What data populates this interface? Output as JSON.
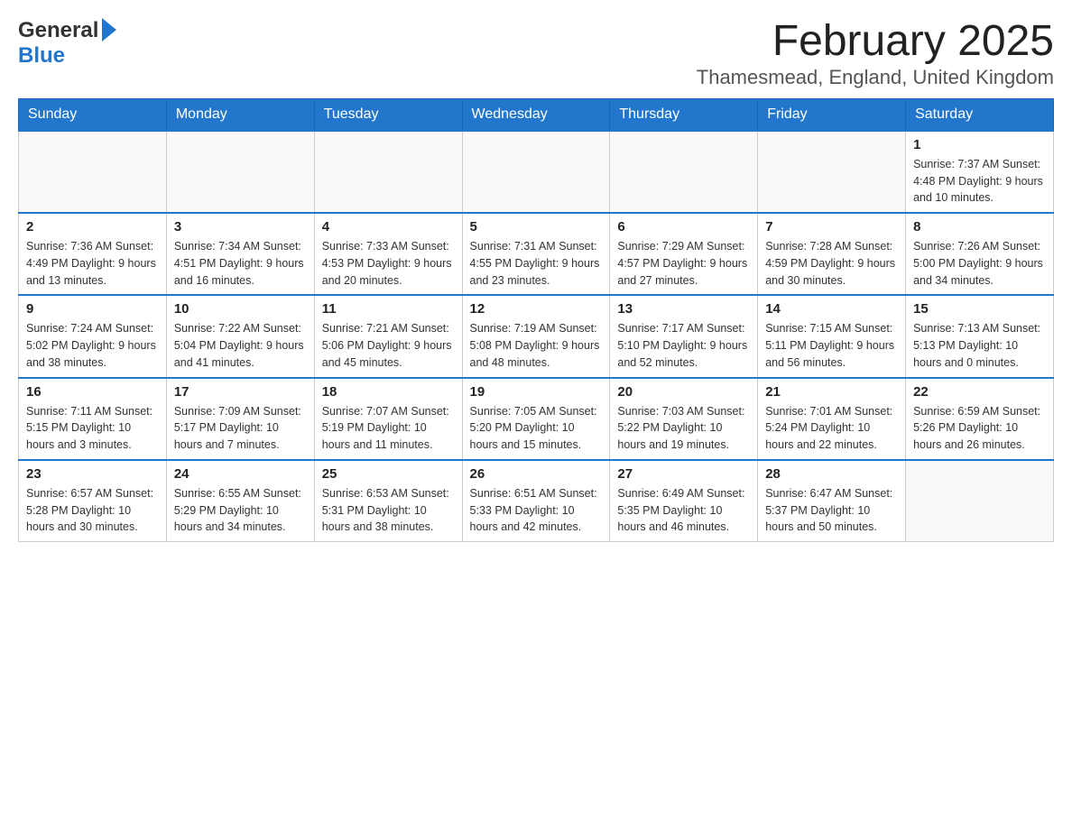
{
  "header": {
    "logo_general": "General",
    "logo_blue": "Blue",
    "title": "February 2025",
    "subtitle": "Thamesmead, England, United Kingdom"
  },
  "calendar": {
    "days_of_week": [
      "Sunday",
      "Monday",
      "Tuesday",
      "Wednesday",
      "Thursday",
      "Friday",
      "Saturday"
    ],
    "weeks": [
      [
        {
          "day": "",
          "info": ""
        },
        {
          "day": "",
          "info": ""
        },
        {
          "day": "",
          "info": ""
        },
        {
          "day": "",
          "info": ""
        },
        {
          "day": "",
          "info": ""
        },
        {
          "day": "",
          "info": ""
        },
        {
          "day": "1",
          "info": "Sunrise: 7:37 AM\nSunset: 4:48 PM\nDaylight: 9 hours and 10 minutes."
        }
      ],
      [
        {
          "day": "2",
          "info": "Sunrise: 7:36 AM\nSunset: 4:49 PM\nDaylight: 9 hours and 13 minutes."
        },
        {
          "day": "3",
          "info": "Sunrise: 7:34 AM\nSunset: 4:51 PM\nDaylight: 9 hours and 16 minutes."
        },
        {
          "day": "4",
          "info": "Sunrise: 7:33 AM\nSunset: 4:53 PM\nDaylight: 9 hours and 20 minutes."
        },
        {
          "day": "5",
          "info": "Sunrise: 7:31 AM\nSunset: 4:55 PM\nDaylight: 9 hours and 23 minutes."
        },
        {
          "day": "6",
          "info": "Sunrise: 7:29 AM\nSunset: 4:57 PM\nDaylight: 9 hours and 27 minutes."
        },
        {
          "day": "7",
          "info": "Sunrise: 7:28 AM\nSunset: 4:59 PM\nDaylight: 9 hours and 30 minutes."
        },
        {
          "day": "8",
          "info": "Sunrise: 7:26 AM\nSunset: 5:00 PM\nDaylight: 9 hours and 34 minutes."
        }
      ],
      [
        {
          "day": "9",
          "info": "Sunrise: 7:24 AM\nSunset: 5:02 PM\nDaylight: 9 hours and 38 minutes."
        },
        {
          "day": "10",
          "info": "Sunrise: 7:22 AM\nSunset: 5:04 PM\nDaylight: 9 hours and 41 minutes."
        },
        {
          "day": "11",
          "info": "Sunrise: 7:21 AM\nSunset: 5:06 PM\nDaylight: 9 hours and 45 minutes."
        },
        {
          "day": "12",
          "info": "Sunrise: 7:19 AM\nSunset: 5:08 PM\nDaylight: 9 hours and 48 minutes."
        },
        {
          "day": "13",
          "info": "Sunrise: 7:17 AM\nSunset: 5:10 PM\nDaylight: 9 hours and 52 minutes."
        },
        {
          "day": "14",
          "info": "Sunrise: 7:15 AM\nSunset: 5:11 PM\nDaylight: 9 hours and 56 minutes."
        },
        {
          "day": "15",
          "info": "Sunrise: 7:13 AM\nSunset: 5:13 PM\nDaylight: 10 hours and 0 minutes."
        }
      ],
      [
        {
          "day": "16",
          "info": "Sunrise: 7:11 AM\nSunset: 5:15 PM\nDaylight: 10 hours and 3 minutes."
        },
        {
          "day": "17",
          "info": "Sunrise: 7:09 AM\nSunset: 5:17 PM\nDaylight: 10 hours and 7 minutes."
        },
        {
          "day": "18",
          "info": "Sunrise: 7:07 AM\nSunset: 5:19 PM\nDaylight: 10 hours and 11 minutes."
        },
        {
          "day": "19",
          "info": "Sunrise: 7:05 AM\nSunset: 5:20 PM\nDaylight: 10 hours and 15 minutes."
        },
        {
          "day": "20",
          "info": "Sunrise: 7:03 AM\nSunset: 5:22 PM\nDaylight: 10 hours and 19 minutes."
        },
        {
          "day": "21",
          "info": "Sunrise: 7:01 AM\nSunset: 5:24 PM\nDaylight: 10 hours and 22 minutes."
        },
        {
          "day": "22",
          "info": "Sunrise: 6:59 AM\nSunset: 5:26 PM\nDaylight: 10 hours and 26 minutes."
        }
      ],
      [
        {
          "day": "23",
          "info": "Sunrise: 6:57 AM\nSunset: 5:28 PM\nDaylight: 10 hours and 30 minutes."
        },
        {
          "day": "24",
          "info": "Sunrise: 6:55 AM\nSunset: 5:29 PM\nDaylight: 10 hours and 34 minutes."
        },
        {
          "day": "25",
          "info": "Sunrise: 6:53 AM\nSunset: 5:31 PM\nDaylight: 10 hours and 38 minutes."
        },
        {
          "day": "26",
          "info": "Sunrise: 6:51 AM\nSunset: 5:33 PM\nDaylight: 10 hours and 42 minutes."
        },
        {
          "day": "27",
          "info": "Sunrise: 6:49 AM\nSunset: 5:35 PM\nDaylight: 10 hours and 46 minutes."
        },
        {
          "day": "28",
          "info": "Sunrise: 6:47 AM\nSunset: 5:37 PM\nDaylight: 10 hours and 50 minutes."
        },
        {
          "day": "",
          "info": ""
        }
      ]
    ]
  }
}
